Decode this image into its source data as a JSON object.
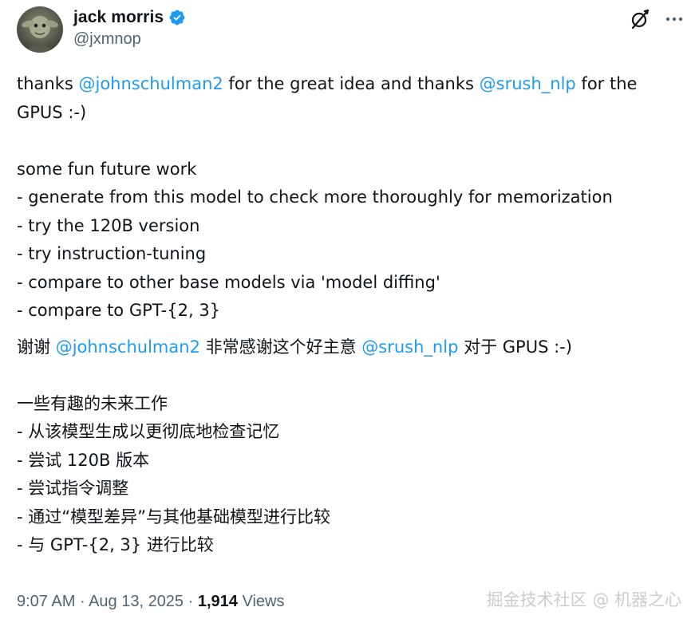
{
  "author": {
    "display_name": "jack morris",
    "handle": "@jxmnop",
    "verified_badge_icon": "verified-badge-icon"
  },
  "header_actions": {
    "grok_icon": "grok-icon",
    "more_icon": "more-icon"
  },
  "tweet": {
    "en": {
      "line1": {
        "a": "thanks ",
        "mention1": "@johnschulman2",
        "b": " for the great idea and thanks ",
        "mention2": "@srush_nlp",
        "c": " for the"
      },
      "line2": "GPUS :-)",
      "future_title": "some fun future work",
      "items": [
        "- generate from this model to check more thoroughly for memorization",
        "- try the 120B version",
        "- try instruction-tuning",
        "- compare to other base models via 'model diffing'",
        "- compare to GPT-{2, 3}"
      ]
    },
    "zh": {
      "line1": {
        "a": "谢谢 ",
        "mention1": "@johnschulman2",
        "b": " 非常感谢这个好主意 ",
        "mention2": "@srush_nlp",
        "c": " 对于 GPUS :-)"
      },
      "future_title": "一些有趣的未来工作",
      "items": [
        "- 从该模型生成以更彻底地检查记忆",
        "- 尝试 120B 版本",
        "- 尝试指令调整",
        "- 通过“模型差异”与其他基础模型进行比较",
        "- 与 GPT-{2, 3} 进行比较"
      ]
    }
  },
  "footer": {
    "time": "9:07 AM",
    "sep1": " · ",
    "date": "Aug 13, 2025",
    "sep2": " · ",
    "views_count": "1,914",
    "views_label": " Views"
  },
  "watermark": "掘金技术社区 @ 机器之心",
  "colors": {
    "link": "#1d9bf0",
    "text": "#0f1419",
    "secondary": "#536471",
    "verified": "#1d9bf0"
  }
}
